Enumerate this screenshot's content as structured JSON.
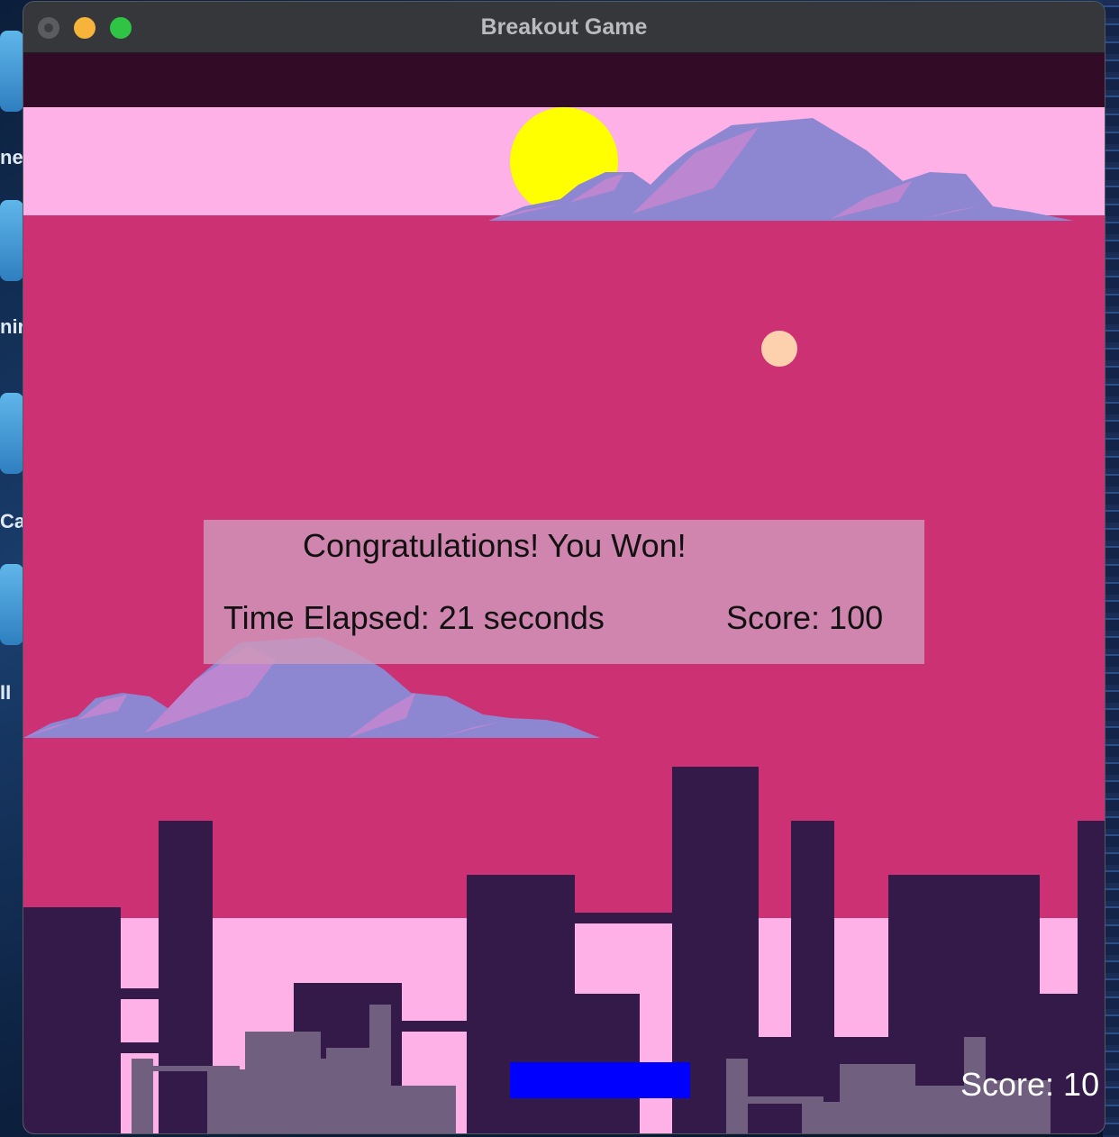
{
  "window": {
    "title": "Breakout Game"
  },
  "desktop": {
    "icon_labels": [
      "nes",
      "nir",
      "Ca",
      "II"
    ]
  },
  "game": {
    "colors": {
      "top_band": "#320b27",
      "sky": "#feb1e6",
      "background": "#cc3174",
      "sun": "#ffff00",
      "ball": "#fdd1ad",
      "paddle": "#0000fe",
      "buildings_dark": "#331a48",
      "buildings_light": "#715f80",
      "cloud_main": "#8d87d2",
      "cloud_highlight": "#bd86d1"
    },
    "overlay": {
      "title": "Congratulations! You Won!",
      "time_elapsed": "Time Elapsed: 21 seconds",
      "score": "Score: 100"
    },
    "hud": {
      "score": "Score: 10"
    }
  }
}
